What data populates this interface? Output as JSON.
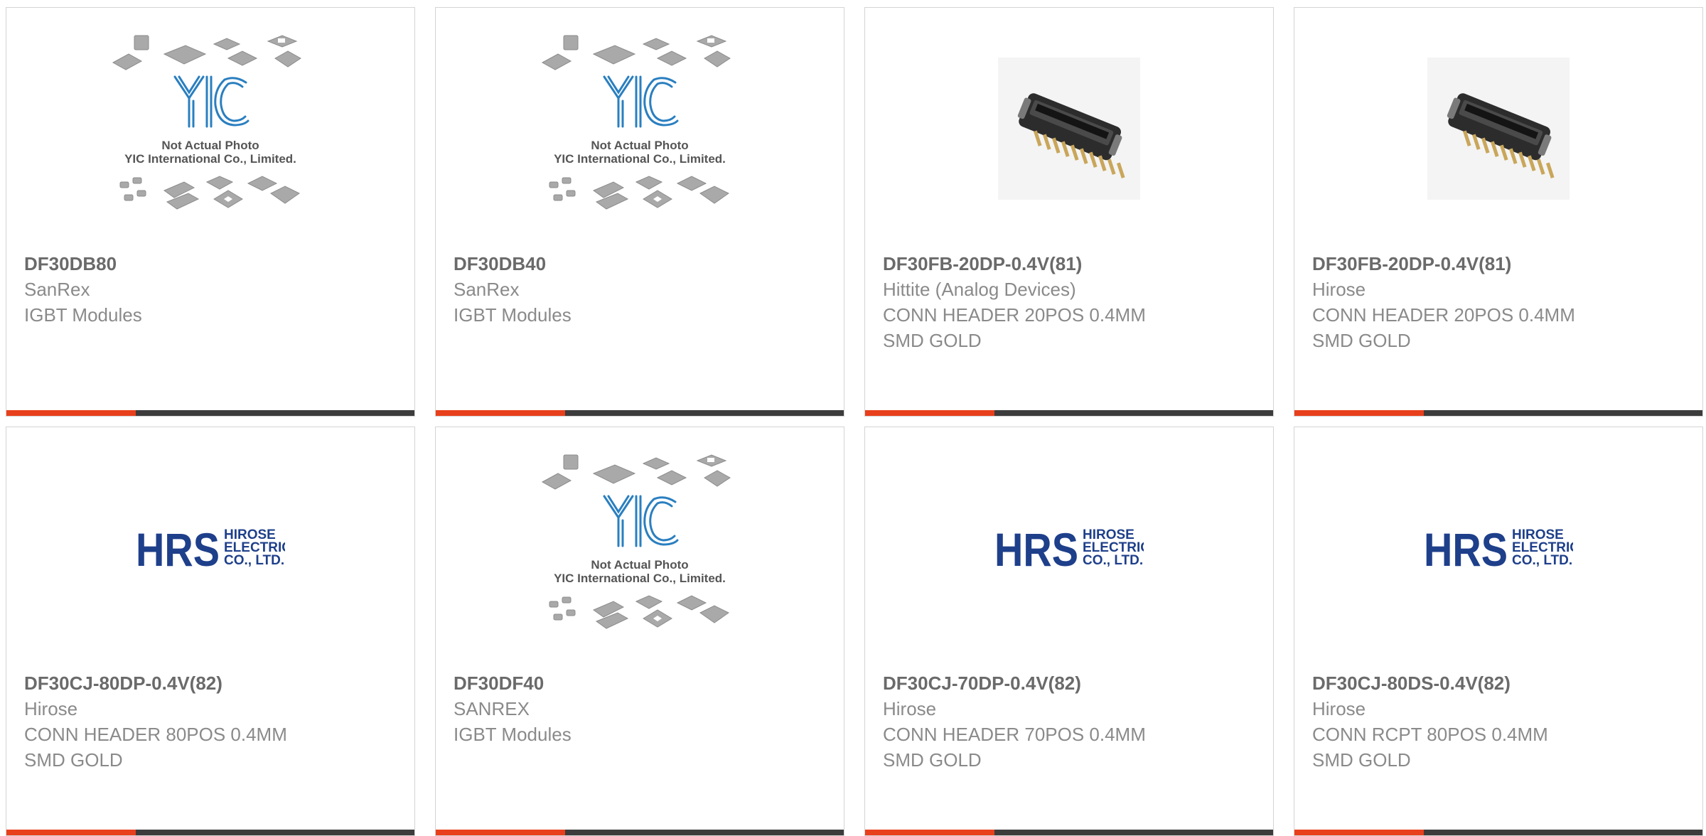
{
  "colors": {
    "accent": "#e8401c",
    "bar": "#3c3c3c",
    "yic_blue": "#2a7fc0",
    "hrs_blue": "#1e3f8a"
  },
  "placeholder": {
    "line1": "Not Actual Photo",
    "line2": "YIC International Co., Limited."
  },
  "hrs_logo": {
    "mark": "HRS",
    "line1": "HIROSE",
    "line2": "ELECTRIC",
    "line3": "CO., LTD."
  },
  "products": [
    {
      "part": "DF30DB80",
      "manufacturer": "SanRex",
      "desc1": "IGBT Modules",
      "desc2": "",
      "image": "yic-placeholder"
    },
    {
      "part": "DF30DB40",
      "manufacturer": "SanRex",
      "desc1": "IGBT Modules",
      "desc2": "",
      "image": "yic-placeholder"
    },
    {
      "part": "DF30FB-20DP-0.4V(81)",
      "manufacturer": "Hittite (Analog Devices)",
      "desc1": "CONN HEADER 20POS 0.4MM",
      "desc2": "SMD GOLD",
      "image": "connector-photo"
    },
    {
      "part": "DF30FB-20DP-0.4V(81)",
      "manufacturer": "Hirose",
      "desc1": "CONN HEADER 20POS 0.4MM",
      "desc2": "SMD GOLD",
      "image": "connector-photo"
    },
    {
      "part": "DF30CJ-80DP-0.4V(82)",
      "manufacturer": "Hirose",
      "desc1": "CONN HEADER 80POS 0.4MM",
      "desc2": "SMD GOLD",
      "image": "hrs-logo"
    },
    {
      "part": "DF30DF40",
      "manufacturer": "SANREX",
      "desc1": "IGBT Modules",
      "desc2": "",
      "image": "yic-placeholder"
    },
    {
      "part": "DF30CJ-70DP-0.4V(82)",
      "manufacturer": "Hirose",
      "desc1": "CONN HEADER 70POS 0.4MM",
      "desc2": "SMD GOLD",
      "image": "hrs-logo"
    },
    {
      "part": "DF30CJ-80DS-0.4V(82)",
      "manufacturer": "Hirose",
      "desc1": "CONN RCPT 80POS 0.4MM",
      "desc2": "SMD GOLD",
      "image": "hrs-logo"
    }
  ]
}
